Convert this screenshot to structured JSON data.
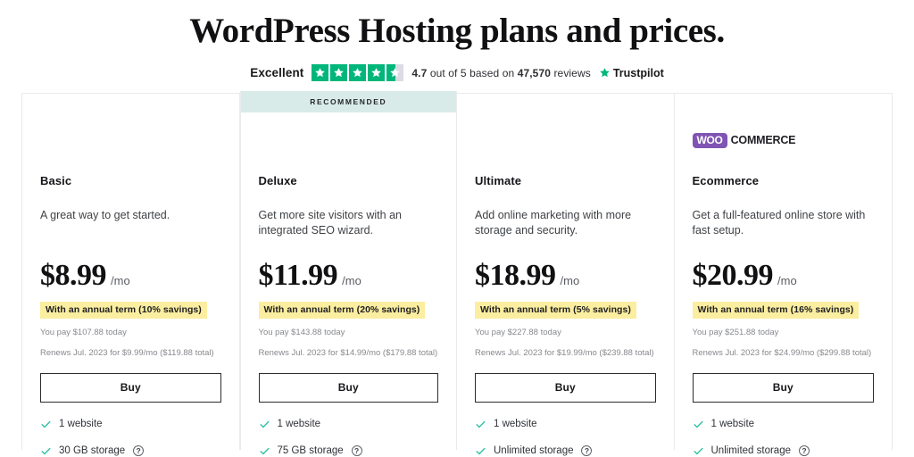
{
  "header": {
    "title": "WordPress Hosting plans and prices.",
    "trustpilot": {
      "rating_word": "Excellent",
      "stars_filled": 4.5,
      "score_prefix": "4.7",
      "score_middle": " out of 5 based on ",
      "review_count": "47,570",
      "score_suffix": " reviews",
      "brand": "Trustpilot",
      "star_color": "#00b67a",
      "empty_star_color": "#dcdce6"
    }
  },
  "ribbon": {
    "label": "RECOMMENDED",
    "background": "#d9ebe8"
  },
  "colors": {
    "savings_badge": "#fbeea0",
    "check": "#2bbfa0",
    "woo_purple": "#7f54b3"
  },
  "plans": [
    {
      "name": "Basic",
      "description": "A great way to get started.",
      "price": "$8.99",
      "per": "/mo",
      "savings": "With an annual term (10% savings)",
      "today": "You pay $107.88 today",
      "renews": "Renews Jul. 2023 for $9.99/mo ($119.88 total)",
      "buy_label": "Buy",
      "features": [
        {
          "label": "1 website",
          "help": false
        },
        {
          "label": "30 GB storage",
          "help": true
        }
      ]
    },
    {
      "name": "Deluxe",
      "description": "Get more site visitors with an integrated SEO wizard.",
      "price": "$11.99",
      "per": "/mo",
      "savings": "With an annual term (20% savings)",
      "today": "You pay $143.88 today",
      "renews": "Renews Jul. 2023 for $14.99/mo ($179.88 total)",
      "buy_label": "Buy",
      "features": [
        {
          "label": "1 website",
          "help": false
        },
        {
          "label": "75 GB storage",
          "help": true
        }
      ]
    },
    {
      "name": "Ultimate",
      "description": "Add online marketing with more storage and security.",
      "price": "$18.99",
      "per": "/mo",
      "savings": "With an annual term (5% savings)",
      "today": "You pay $227.88 today",
      "renews": "Renews Jul. 2023 for $19.99/mo ($239.88 total)",
      "buy_label": "Buy",
      "features": [
        {
          "label": "1 website",
          "help": false
        },
        {
          "label": "Unlimited storage",
          "help": true
        }
      ]
    },
    {
      "name": "Ecommerce",
      "description": "Get a full-featured online store with fast setup.",
      "price": "$20.99",
      "per": "/mo",
      "savings": "With an annual term (16% savings)",
      "today": "You pay $251.88 today",
      "renews": "Renews Jul. 2023 for $24.99/mo ($299.88 total)",
      "buy_label": "Buy",
      "badge": {
        "mark": "WOO",
        "word": "COMMERCE"
      },
      "features": [
        {
          "label": "1 website",
          "help": false
        },
        {
          "label": "Unlimited storage",
          "help": true
        }
      ]
    }
  ],
  "help_icon_glyph": "?"
}
